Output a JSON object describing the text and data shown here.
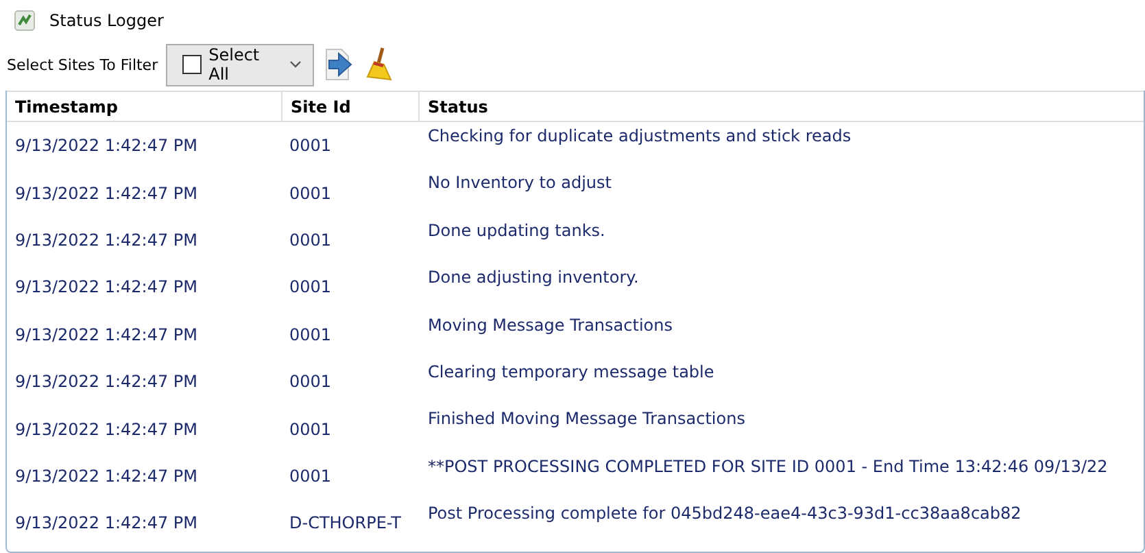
{
  "window": {
    "title": "Status Logger"
  },
  "toolbar": {
    "filter_label": "Select Sites To Filter",
    "filter_dropdown": {
      "label": "Select All",
      "checked": false
    }
  },
  "table": {
    "columns": [
      "Timestamp",
      "Site Id",
      "Status"
    ],
    "rows": [
      {
        "timestamp": "9/13/2022 1:42:47 PM",
        "site_id": "0001",
        "status": "Checking for duplicate adjustments and stick reads"
      },
      {
        "timestamp": "9/13/2022 1:42:47 PM",
        "site_id": "0001",
        "status": "No Inventory to adjust"
      },
      {
        "timestamp": "9/13/2022 1:42:47 PM",
        "site_id": "0001",
        "status": "Done updating tanks."
      },
      {
        "timestamp": "9/13/2022 1:42:47 PM",
        "site_id": "0001",
        "status": "Done adjusting inventory."
      },
      {
        "timestamp": "9/13/2022 1:42:47 PM",
        "site_id": "0001",
        "status": "Moving Message Transactions"
      },
      {
        "timestamp": "9/13/2022 1:42:47 PM",
        "site_id": "0001",
        "status": "Clearing temporary message table"
      },
      {
        "timestamp": "9/13/2022 1:42:47 PM",
        "site_id": "0001",
        "status": "Finished Moving Message Transactions"
      },
      {
        "timestamp": "9/13/2022 1:42:47 PM",
        "site_id": "0001",
        "status": "**POST PROCESSING COMPLETED FOR SITE ID 0001 - End Time 13:42:46 09/13/22"
      },
      {
        "timestamp": "9/13/2022 1:42:47 PM",
        "site_id": "D-CTHORPE-T",
        "status": "Post Processing complete for 045bd248-eae4-43c3-93d1-cc38aa8cab82"
      }
    ]
  }
}
